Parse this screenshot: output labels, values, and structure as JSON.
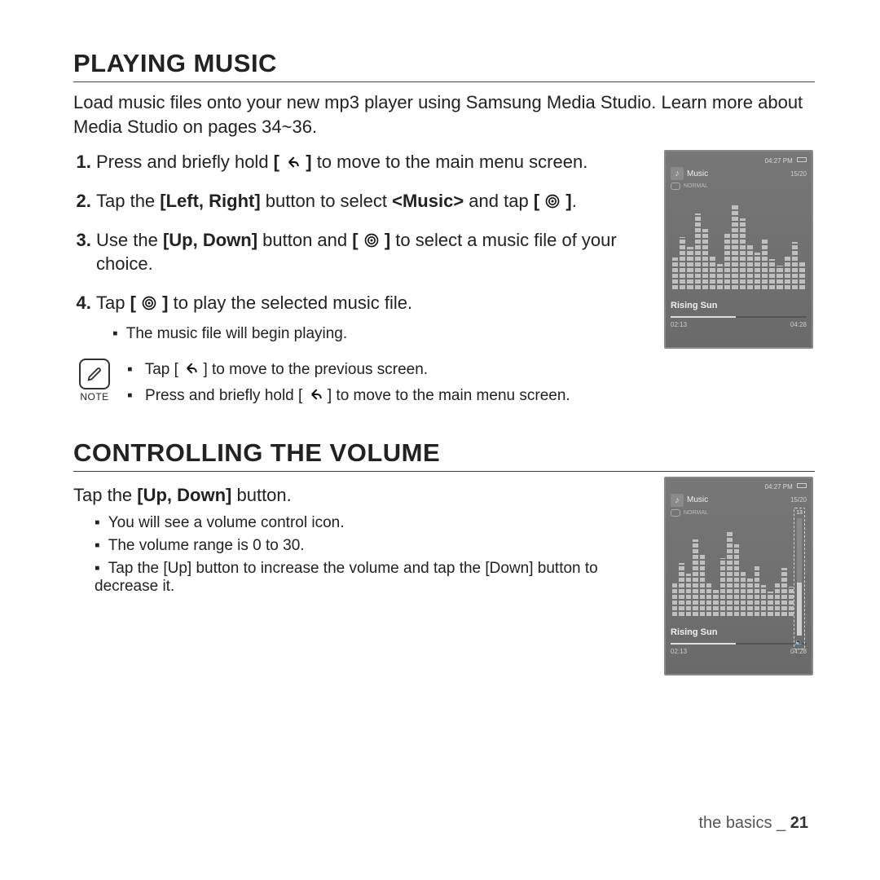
{
  "section1": {
    "title": "PLAYING MUSIC",
    "intro": "Load music files onto your new mp3 player using Samsung Media Studio. Learn more about Media Studio on pages 34~36.",
    "steps": {
      "s1_a": "Press and briefly hold ",
      "s1_b": " to move to the main menu screen.",
      "s2_a": "Tap the ",
      "s2_bold1": "[Left, Right]",
      "s2_b": " button to select ",
      "s2_bold2": "<Music>",
      "s2_c": " and tap ",
      "s2_d": ".",
      "s3_a": "Use the ",
      "s3_bold1": "[Up, Down]",
      "s3_b": " button and ",
      "s3_c": " to select a music file of your choice.",
      "s4_a": "Tap ",
      "s4_b": " to play the selected music file.",
      "s4_sub1": "The music file will begin playing."
    },
    "note": {
      "label": "NOTE",
      "b1_a": "Tap [ ",
      "b1_b": " ] to move to the previous screen.",
      "b2_a": "Press and briefly hold [ ",
      "b2_b": " ] to move to the main menu screen."
    }
  },
  "section2": {
    "title": "CONTROLLING THE VOLUME",
    "lead_a": "Tap the ",
    "lead_bold": "[Up, Down]",
    "lead_b": " button.",
    "bullets": {
      "b1": "You will see a volume control icon.",
      "b2": "The volume range is 0 to 30.",
      "b3": "Tap the [Up] button to increase the volume and tap the [Down] button to decrease it."
    }
  },
  "device": {
    "time": "04:27 PM",
    "app": "Music",
    "counter": "15/20",
    "mode": "NORMAL",
    "track": "Rising Sun",
    "elapsed": "02:13",
    "total": "04:28",
    "vol_level": "13"
  },
  "footer": {
    "chapter": "the basics _ ",
    "page": "21"
  },
  "icons": {
    "back": "back-arrow-icon",
    "target": "select-target-icon",
    "note": "pencil-note-icon",
    "music": "music-note-icon",
    "repeat": "repeat-icon",
    "speaker": "speaker-icon",
    "battery": "battery-icon"
  },
  "spectrum_heights": [
    38,
    62,
    50,
    90,
    72,
    40,
    30,
    68,
    100,
    84,
    52,
    44,
    60,
    36,
    28,
    40,
    56,
    34
  ]
}
